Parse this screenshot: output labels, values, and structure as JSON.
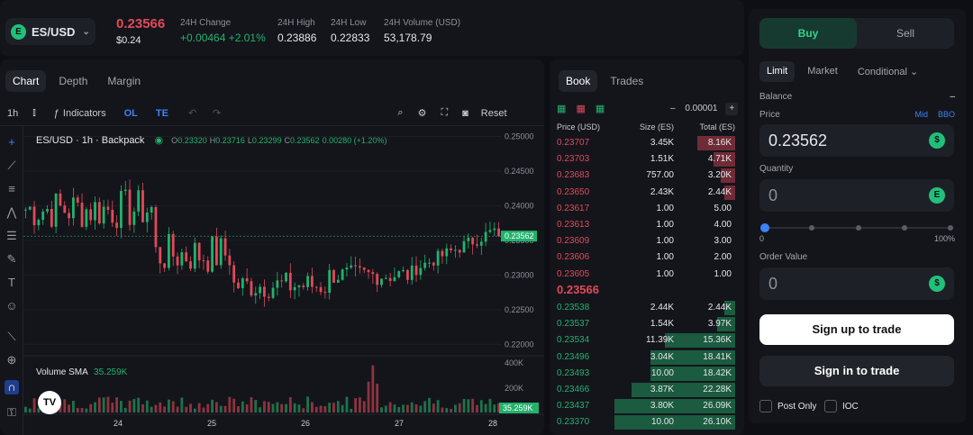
{
  "header": {
    "pair": "ES/USD",
    "last_price": "0.23566",
    "last_price_usd": "$0.24",
    "stats": [
      {
        "label": "24H Change",
        "value": "+0.00464 +2.01%",
        "color": "#23b26d"
      },
      {
        "label": "24H High",
        "value": "0.23886"
      },
      {
        "label": "24H Low",
        "value": "0.22833"
      },
      {
        "label": "24H Volume (USD)",
        "value": "53,178.79"
      }
    ]
  },
  "chart_panel": {
    "tabs": [
      "Chart",
      "Depth",
      "Margin"
    ],
    "toolbar": {
      "interval": "1h",
      "indicators": "Indicators",
      "ol": "OL",
      "te": "TE",
      "reset": "Reset"
    },
    "legend": {
      "title": "ES/USD · 1h · Backpack",
      "o": "0.23320",
      "h": "0.23716",
      "l": "0.23299",
      "c": "0.23562",
      "change": "0.00280 (+1.20%)"
    },
    "price_axis": [
      "0.25000",
      "0.24500",
      "0.24000",
      "0.23500",
      "0.23000",
      "0.22500",
      "0.22000"
    ],
    "current_price_tag": "0.23562",
    "volume_label": "Volume SMA",
    "volume_value": "35.259K",
    "volume_axis": [
      "400K",
      "200K"
    ],
    "volume_tag": "35.259K",
    "x_axis": [
      "24",
      "25",
      "26",
      "27",
      "28"
    ]
  },
  "book_panel": {
    "tabs": [
      "Book",
      "Trades"
    ],
    "tick_size": "0.00001",
    "columns": [
      "Price (USD)",
      "Size (ES)",
      "Total (ES)"
    ],
    "asks": [
      {
        "price": "0.23707",
        "size": "3.45K",
        "total": "8.16K",
        "depth": 0.31
      },
      {
        "price": "0.23703",
        "size": "1.51K",
        "total": "4.71K",
        "depth": 0.18
      },
      {
        "price": "0.23683",
        "size": "757.00",
        "total": "3.20K",
        "depth": 0.12
      },
      {
        "price": "0.23650",
        "size": "2.43K",
        "total": "2.44K",
        "depth": 0.09
      },
      {
        "price": "0.23617",
        "size": "1.00",
        "total": "5.00",
        "depth": 0.0
      },
      {
        "price": "0.23613",
        "size": "1.00",
        "total": "4.00",
        "depth": 0.0
      },
      {
        "price": "0.23609",
        "size": "1.00",
        "total": "3.00",
        "depth": 0.0
      },
      {
        "price": "0.23606",
        "size": "1.00",
        "total": "2.00",
        "depth": 0.0
      },
      {
        "price": "0.23605",
        "size": "1.00",
        "total": "1.00",
        "depth": 0.0
      }
    ],
    "mid_price": "0.23566",
    "bids": [
      {
        "price": "0.23538",
        "size": "2.44K",
        "total": "2.44K",
        "depth": 0.09
      },
      {
        "price": "0.23537",
        "size": "1.54K",
        "total": "3.97K",
        "depth": 0.15
      },
      {
        "price": "0.23534",
        "size": "11.39K",
        "total": "15.36K",
        "depth": 0.58
      },
      {
        "price": "0.23496",
        "size": "3.04K",
        "total": "18.41K",
        "depth": 0.7
      },
      {
        "price": "0.23493",
        "size": "10.00",
        "total": "18.42K",
        "depth": 0.7
      },
      {
        "price": "0.23466",
        "size": "3.87K",
        "total": "22.28K",
        "depth": 0.85
      },
      {
        "price": "0.23437",
        "size": "3.80K",
        "total": "26.09K",
        "depth": 0.99
      },
      {
        "price": "0.23370",
        "size": "10.00",
        "total": "26.10K",
        "depth": 0.99
      }
    ]
  },
  "order_panel": {
    "buy_label": "Buy",
    "sell_label": "Sell",
    "order_types": [
      "Limit",
      "Market",
      "Conditional"
    ],
    "balance_label": "Balance",
    "balance_value": "–",
    "price_label": "Price",
    "mid_label": "Mid",
    "bbo_label": "BBO",
    "price_value": "0.23562",
    "quantity_label": "Quantity",
    "quantity_value": "0",
    "slider_min": "0",
    "slider_max": "100%",
    "order_value_label": "Order Value",
    "order_value": "0",
    "signup_label": "Sign up to trade",
    "signin_label": "Sign in to trade",
    "post_only_label": "Post Only",
    "ioc_label": "IOC"
  },
  "colors": {
    "green": "#23b26d",
    "red": "#e04a59",
    "accent_blue": "#3b82f6"
  }
}
